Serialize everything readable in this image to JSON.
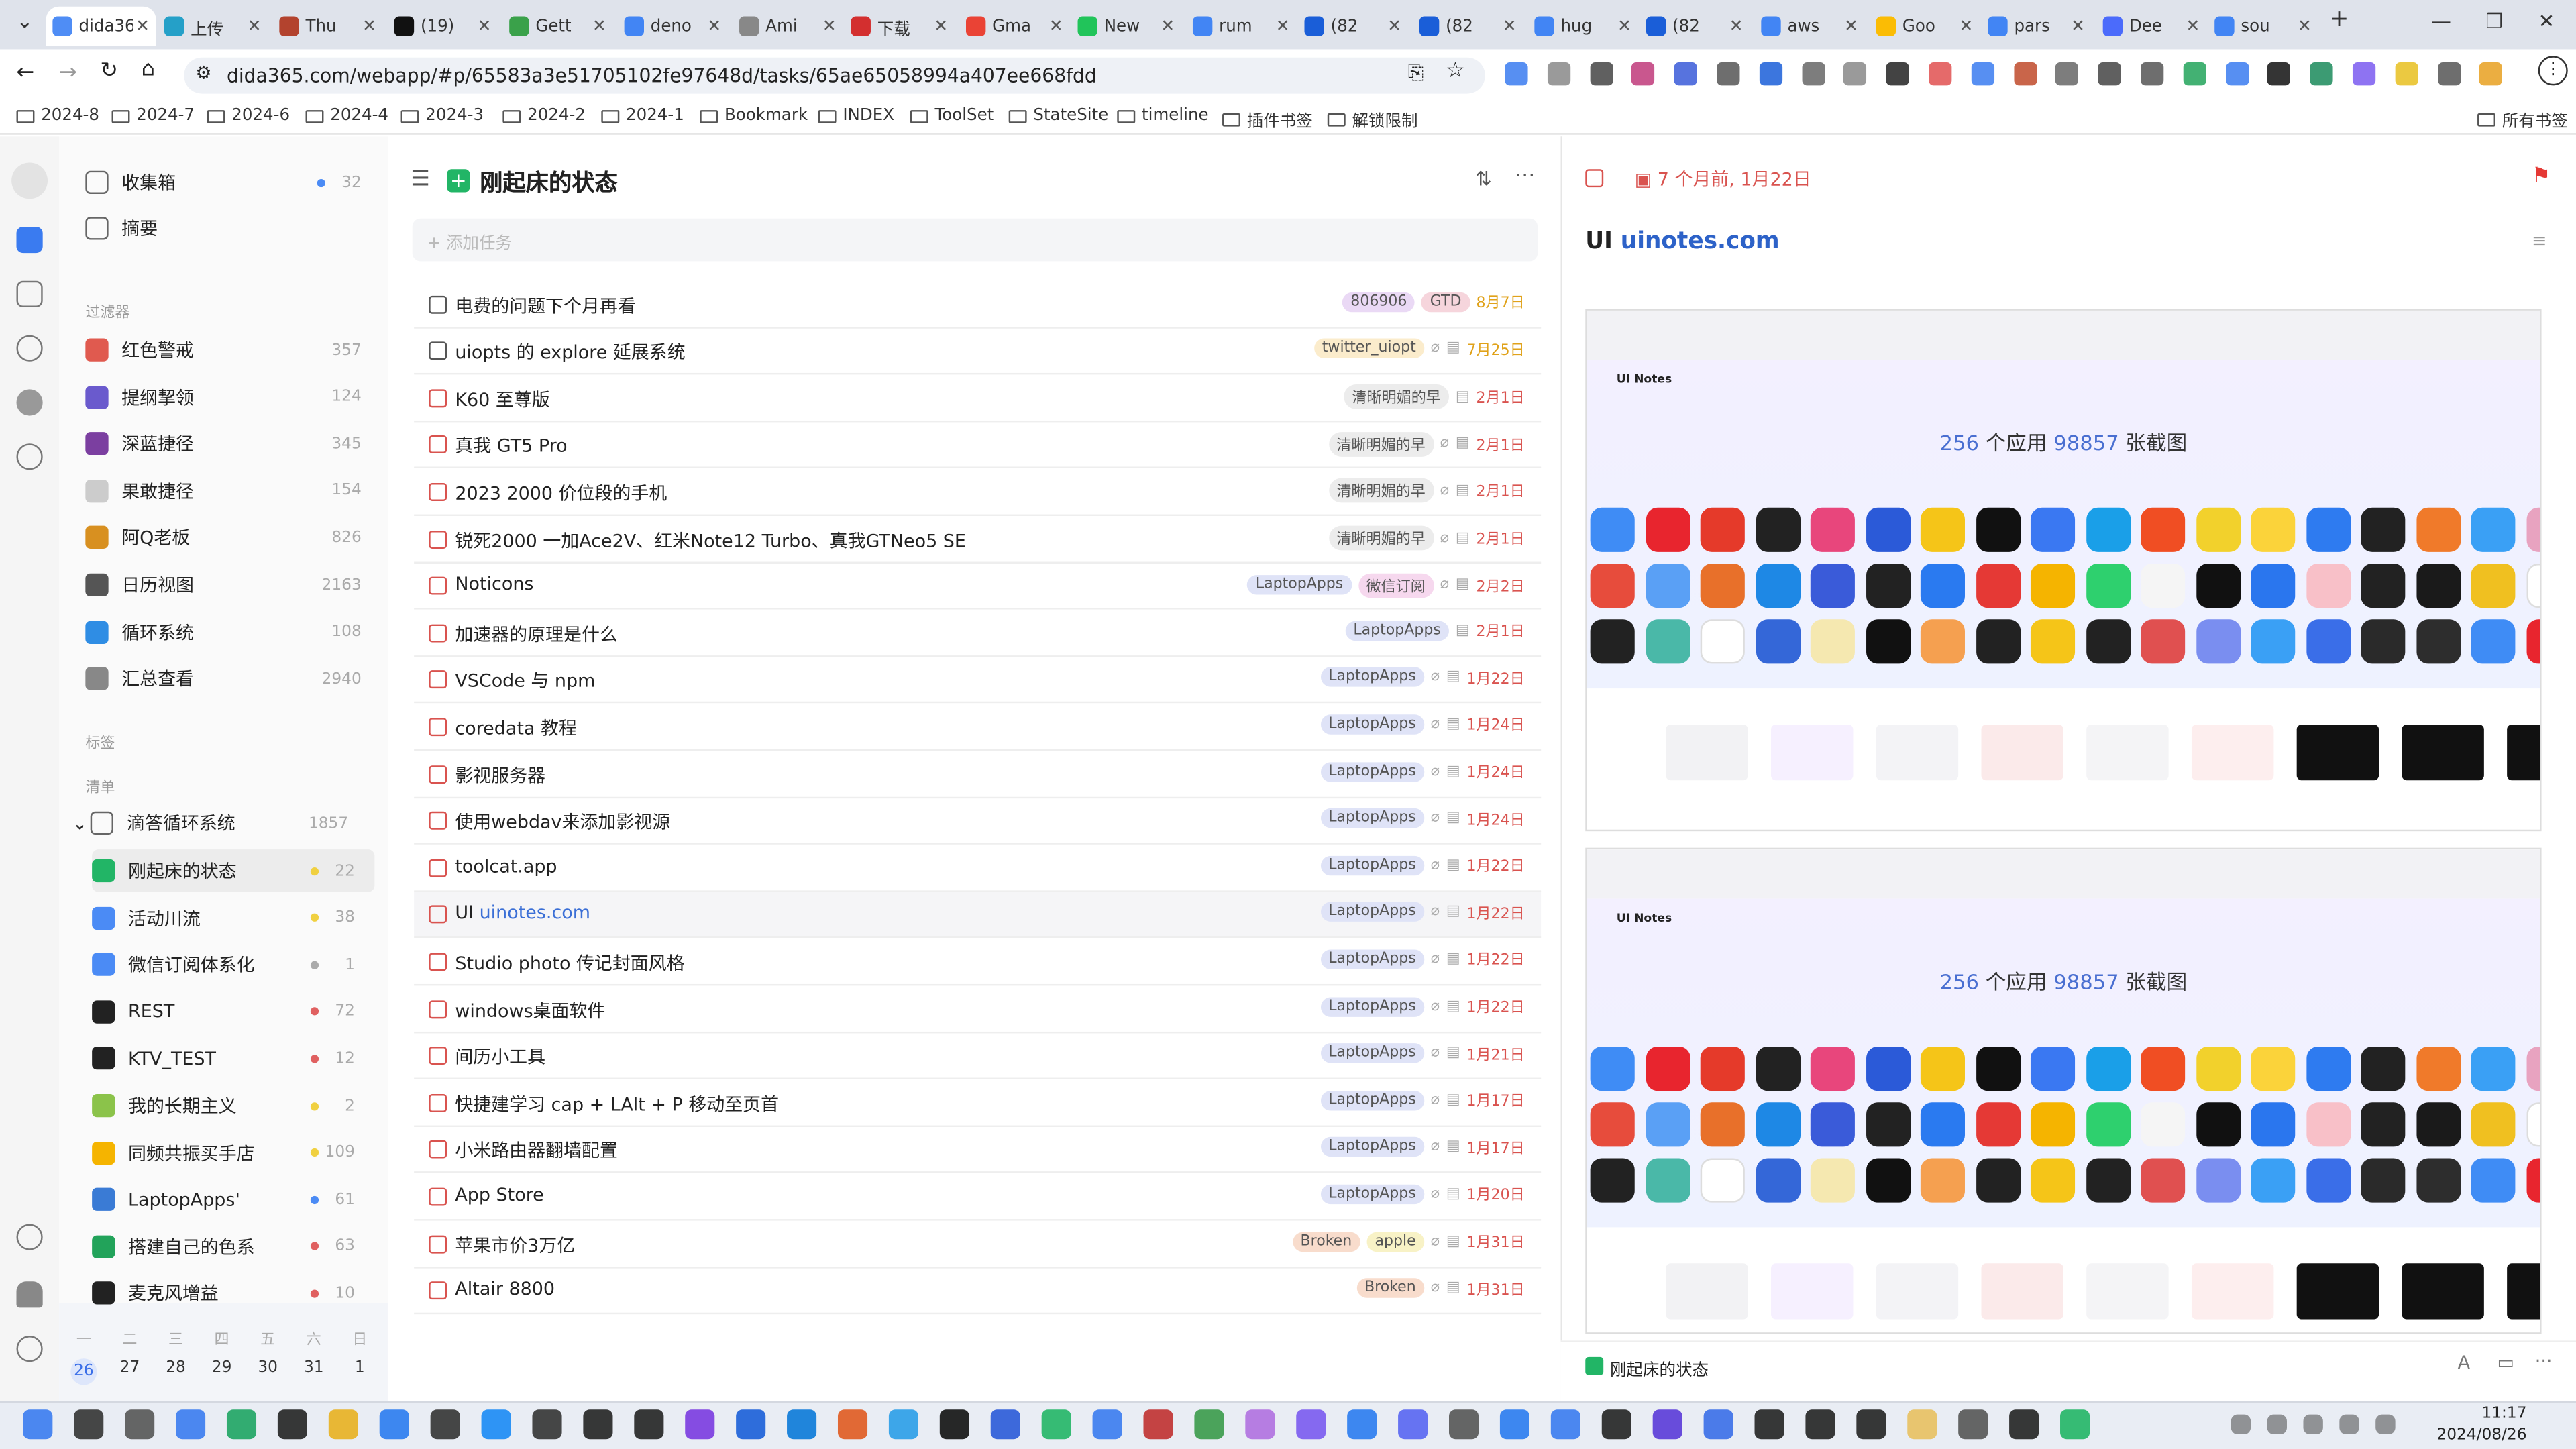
{
  "browser": {
    "tabs": [
      {
        "label": "dida365",
        "active": true,
        "color": "#4f8df5"
      },
      {
        "label": "上传",
        "color": "#25a0c8"
      },
      {
        "label": "Thu",
        "color": "#b3432e"
      },
      {
        "label": "(19)",
        "color": "#111111"
      },
      {
        "label": "Gett",
        "color": "#3aa14a"
      },
      {
        "label": "deno",
        "color": "#4285f4"
      },
      {
        "label": "Ami",
        "color": "#888888"
      },
      {
        "label": "下载",
        "color": "#d32f2f"
      },
      {
        "label": "Gma",
        "color": "#ea4335"
      },
      {
        "label": "New",
        "color": "#21c45a"
      },
      {
        "label": "rum",
        "color": "#4285f4"
      },
      {
        "label": "(82",
        "color": "#1a5ed8"
      },
      {
        "label": "(82",
        "color": "#1a5ed8"
      },
      {
        "label": "hug",
        "color": "#4285f4"
      },
      {
        "label": "(82",
        "color": "#1a5ed8"
      },
      {
        "label": "aws",
        "color": "#4285f4"
      },
      {
        "label": "Goo",
        "color": "#fbbc04"
      },
      {
        "label": "pars",
        "color": "#4285f4"
      },
      {
        "label": "Dee",
        "color": "#4b6bfb"
      },
      {
        "label": "sou",
        "color": "#4285f4"
      }
    ],
    "url": "dida365.com/webapp/#p/65583a3e51705102fe97648d/tasks/65ae65058994a407ee668fdd",
    "bookmarks": [
      "2024-8",
      "2024-7",
      "2024-6",
      "2024-4",
      "2024-3",
      "2024-2",
      "2024-1",
      "Bookmark",
      "INDEX",
      "ToolSet",
      "StateSite",
      "timeline",
      "插件书签",
      "解锁限制"
    ],
    "all_bookmarks": "所有书签"
  },
  "sidebar": {
    "top": [
      {
        "label": "收集箱",
        "count": "32",
        "dot": "#4b8bf5",
        "icon": "inbox-icon"
      },
      {
        "label": "摘要",
        "count": "",
        "icon": "summary-icon"
      }
    ],
    "filters_header": "过滤器",
    "filters": [
      {
        "label": "红色警戒",
        "count": "357",
        "icon": "alert-icon",
        "color": "#e05a4f"
      },
      {
        "label": "提纲挈领",
        "count": "124",
        "icon": "sword-icon",
        "color": "#6a5acd"
      },
      {
        "label": "深蓝捷径",
        "count": "345",
        "icon": "eggplant-icon",
        "color": "#7b3fa0"
      },
      {
        "label": "果敢捷径",
        "count": "154",
        "icon": "cloud-icon",
        "color": "#cccccc"
      },
      {
        "label": "阿Q老板",
        "count": "826",
        "icon": "stripes-icon",
        "color": "#d89020"
      },
      {
        "label": "日历视图",
        "count": "2163",
        "icon": "calendar-icon",
        "color": "#555555"
      },
      {
        "label": "循环系统",
        "count": "108",
        "icon": "diamond-icon",
        "color": "#2f8de4"
      },
      {
        "label": "汇总查看",
        "count": "2940",
        "icon": "chart-icon",
        "color": "#888888"
      }
    ],
    "tags_header": "标签",
    "lists_header": "清单",
    "folder": {
      "label": "滴答循环系统",
      "count": "1857"
    },
    "lists": [
      {
        "label": "刚起床的状态",
        "count": "22",
        "dot": "#f0d040",
        "selected": true,
        "icon": "plus-square-icon",
        "color": "#22b566"
      },
      {
        "label": "活动川流",
        "count": "38",
        "dot": "#f0d040",
        "icon": "bus-icon",
        "color": "#4b8bf5"
      },
      {
        "label": "微信订阅体系化",
        "count": "1",
        "dot": "#aaaaaa",
        "icon": "ship-icon",
        "color": "#4b8bf5"
      },
      {
        "label": "REST",
        "count": "72",
        "dot": "#e06060",
        "icon": "music-icon",
        "color": "#222222"
      },
      {
        "label": "KTV_TEST",
        "count": "12",
        "dot": "#e06060",
        "icon": "music-note-icon",
        "color": "#222222"
      },
      {
        "label": "我的长期主义",
        "count": "2",
        "dot": "#f0d040",
        "icon": "bottle-icon",
        "color": "#8bc34a"
      },
      {
        "label": "同频共振买手店",
        "count": "109",
        "dot": "#f0d040",
        "icon": "hand-icon",
        "color": "#f5b400"
      },
      {
        "label": "LaptopApps'",
        "count": "61",
        "dot": "#4b8bf5",
        "icon": "swirl-icon",
        "color": "#3a7bd5"
      },
      {
        "label": "搭建自己的色系",
        "count": "63",
        "dot": "#e06060",
        "icon": "clover-icon",
        "color": "#22a35a"
      },
      {
        "label": "麦克风增益",
        "count": "10",
        "dot": "#e06060",
        "icon": "mic-icon",
        "color": "#222222"
      }
    ]
  },
  "calendar": {
    "weekdays": [
      "一",
      "二",
      "三",
      "四",
      "五",
      "六",
      "日"
    ],
    "days": [
      "26",
      "27",
      "28",
      "29",
      "30",
      "31",
      "1"
    ]
  },
  "list": {
    "title": "刚起床的状态",
    "add_placeholder": "添加任务",
    "tasks": [
      {
        "title": "电费的问题下个月再看",
        "link": "",
        "tags": [
          {
            "t": "806906",
            "bg": "#ead9f5"
          },
          {
            "t": "GTD",
            "bg": "#f6d5dc"
          }
        ],
        "date": "8月7日",
        "cb": "gray",
        "clip": false
      },
      {
        "title": "uiopts 的 explore 延展系统",
        "link": "",
        "tags": [
          {
            "t": "twitter_uiopt",
            "bg": "#fbeccc"
          }
        ],
        "date": "7月25日",
        "cb": "gray",
        "clip": true
      },
      {
        "title": "K60 至尊版",
        "link": "",
        "tags": [
          {
            "t": "清晰明媚的早",
            "bg": "#ececec"
          }
        ],
        "date": "2月1日",
        "cb": "red",
        "clip": false
      },
      {
        "title": "真我 GT5 Pro",
        "link": "",
        "tags": [
          {
            "t": "清晰明媚的早",
            "bg": "#ececec"
          }
        ],
        "date": "2月1日",
        "cb": "red",
        "clip": true
      },
      {
        "title": "2023 2000 价位段的手机",
        "link": "",
        "tags": [
          {
            "t": "清晰明媚的早",
            "bg": "#ececec"
          }
        ],
        "date": "2月1日",
        "cb": "red",
        "clip": true
      },
      {
        "title": "锐死2000 一加Ace2V、红米Note12 Turbo、真我GTNeo5 SE",
        "link": "",
        "tags": [
          {
            "t": "清晰明媚的早",
            "bg": "#ececec"
          }
        ],
        "date": "2月1日",
        "cb": "red",
        "clip": true
      },
      {
        "title": "Noticons",
        "link": "",
        "tags": [
          {
            "t": "LaptopApps",
            "bg": "#dfe3f7"
          },
          {
            "t": "微信订阅",
            "bg": "#f6d8ee"
          }
        ],
        "date": "2月2日",
        "cb": "red",
        "clip": true
      },
      {
        "title": "加速器的原理是什么",
        "link": "",
        "tags": [
          {
            "t": "LaptopApps",
            "bg": "#dfe3f7"
          }
        ],
        "date": "2月1日",
        "cb": "red",
        "clip": false
      },
      {
        "title": "VSCode 与 npm",
        "link": "",
        "tags": [
          {
            "t": "LaptopApps",
            "bg": "#dfe3f7"
          }
        ],
        "date": "1月22日",
        "cb": "red",
        "clip": true
      },
      {
        "title": "coredata 教程",
        "link": "",
        "tags": [
          {
            "t": "LaptopApps",
            "bg": "#dfe3f7"
          }
        ],
        "date": "1月24日",
        "cb": "red",
        "clip": true
      },
      {
        "title": "影视服务器",
        "link": "",
        "tags": [
          {
            "t": "LaptopApps",
            "bg": "#dfe3f7"
          }
        ],
        "date": "1月24日",
        "cb": "red",
        "clip": true
      },
      {
        "title": "使用webdav来添加影视源",
        "link": "",
        "tags": [
          {
            "t": "LaptopApps",
            "bg": "#dfe3f7"
          }
        ],
        "date": "1月24日",
        "cb": "red",
        "clip": true
      },
      {
        "title": "toolcat.app",
        "link": "",
        "tags": [
          {
            "t": "LaptopApps",
            "bg": "#dfe3f7"
          }
        ],
        "date": "1月22日",
        "cb": "red",
        "clip": true
      },
      {
        "title": "UI ",
        "link": "uinotes.com",
        "tags": [
          {
            "t": "LaptopApps",
            "bg": "#dfe3f7"
          }
        ],
        "date": "1月22日",
        "cb": "red",
        "clip": true,
        "hover": true
      },
      {
        "title": "Studio photo 传记封面风格",
        "link": "",
        "tags": [
          {
            "t": "LaptopApps",
            "bg": "#dfe3f7"
          }
        ],
        "date": "1月22日",
        "cb": "red",
        "clip": true
      },
      {
        "title": "windows桌面软件",
        "link": "",
        "tags": [
          {
            "t": "LaptopApps",
            "bg": "#dfe3f7"
          }
        ],
        "date": "1月22日",
        "cb": "red",
        "clip": true
      },
      {
        "title": "间历小工具",
        "link": "",
        "tags": [
          {
            "t": "LaptopApps",
            "bg": "#dfe3f7"
          }
        ],
        "date": "1月21日",
        "cb": "red",
        "clip": true
      },
      {
        "title": "快捷建学习 cap + LAlt + P 移动至页首",
        "link": "",
        "tags": [
          {
            "t": "LaptopApps",
            "bg": "#dfe3f7"
          }
        ],
        "date": "1月17日",
        "cb": "red",
        "clip": true
      },
      {
        "title": "小米路由器翻墙配置",
        "link": "",
        "tags": [
          {
            "t": "LaptopApps",
            "bg": "#dfe3f7"
          }
        ],
        "date": "1月17日",
        "cb": "red",
        "clip": true
      },
      {
        "title": "App Store",
        "link": "",
        "tags": [
          {
            "t": "LaptopApps",
            "bg": "#dfe3f7"
          }
        ],
        "date": "1月20日",
        "cb": "red",
        "clip": true
      },
      {
        "title": "苹果市价3万亿",
        "link": "",
        "tags": [
          {
            "t": "Broken",
            "bg": "#f8dccc"
          },
          {
            "t": "apple",
            "bg": "#f8f2c6"
          }
        ],
        "date": "1月31日",
        "cb": "red",
        "clip": true
      },
      {
        "title": "Altair 8800",
        "link": "",
        "tags": [
          {
            "t": "Broken",
            "bg": "#f8dccc"
          }
        ],
        "date": "1月31日",
        "cb": "red",
        "clip": true
      }
    ]
  },
  "detail": {
    "date_text": "7 个月前, 1月22日",
    "title_prefix": "UI ",
    "title_link": "uinotes.com",
    "list_name": "刚起床的状态",
    "flag_color": "#e53935",
    "shot": {
      "logo": "UI Notes",
      "headline_pre": "256",
      "headline_mid": " 个应用 ",
      "headline_num": "98857",
      "headline_post": " 张截图"
    }
  },
  "taskbar": {
    "time": "11:17",
    "date": "2024/08/26"
  },
  "app_icon_colors": [
    "#3f8cf5",
    "#e8252e",
    "#e53a2a",
    "#222222",
    "#e8467c",
    "#2b5ad8",
    "#f5c518",
    "#111111",
    "#3a78f2",
    "#1a9fe8",
    "#f04e23",
    "#f2d12c",
    "#fbd33a",
    "#2e7bf0",
    "#222222",
    "#f07a2a",
    "#3aa0f5",
    "#e8a3c0",
    "#e74c3c",
    "#5aa0f5",
    "#e8702a",
    "#1e88e5",
    "#3a5bd9",
    "#222222",
    "#2a7af0",
    "#e53935",
    "#f5b400",
    "#2ed06e",
    "#f5f5f5",
    "#111111",
    "#2a76ee",
    "#f8c0c8",
    "#222222",
    "#1a1a1a",
    "#f0c020",
    "#ffffff",
    "#222222",
    "#4ab8a8",
    "#ffffff",
    "#3467d8",
    "#f5e8b0",
    "#111111",
    "#f5a050",
    "#222222",
    "#f5c518",
    "#222222",
    "#e05050",
    "#7a8ef0",
    "#3aa0f5",
    "#3a6ee8",
    "#2a2a2a",
    "#2d2d2d"
  ]
}
